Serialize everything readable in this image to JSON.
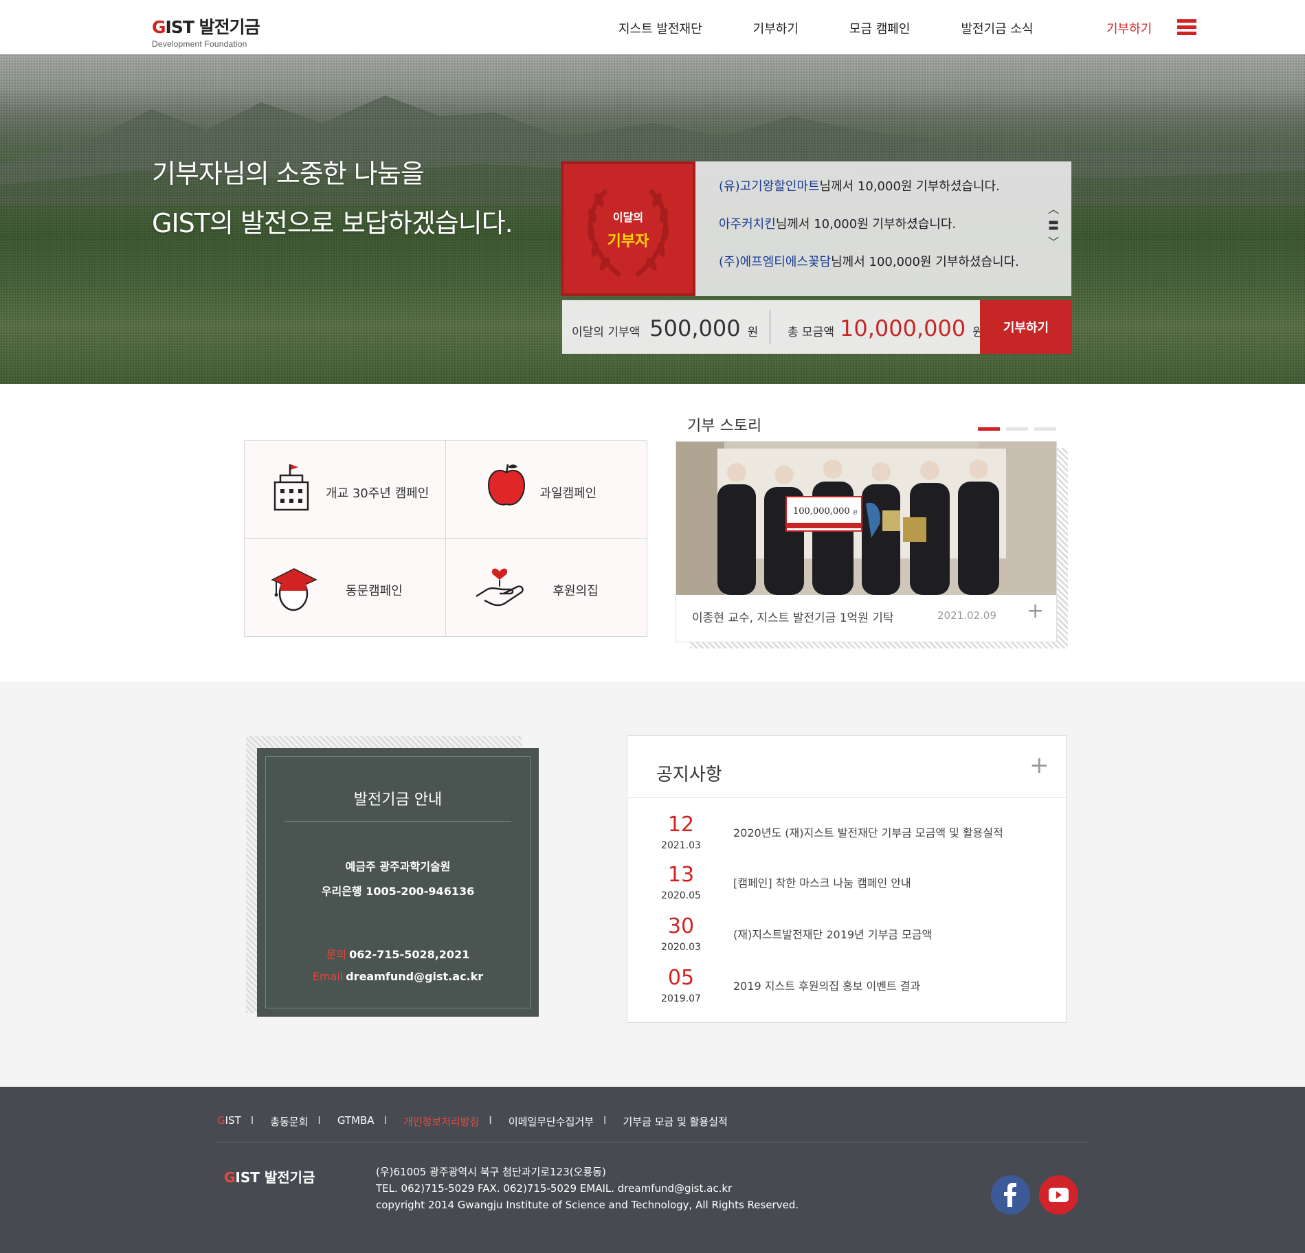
{
  "header": {
    "logo_gist": "GIST",
    "logo_name": "발전기금",
    "logo_sub": "Development Foundation",
    "nav": [
      "지스트 발전재단",
      "기부하기",
      "모금 캠페인",
      "발전기금 소식"
    ],
    "donate_label": "기부하기",
    "menu_icon": "hamburger-icon"
  },
  "hero": {
    "line1": "기부자님의 소중한 나눔을",
    "line2": "GIST의 발전으로 보답하겠습니다.",
    "badge_line1": "이달의",
    "badge_line2": "기부자",
    "donors": [
      {
        "name": "(유)고기왕할인마트",
        "text": "님께서 10,000원 기부하셨습니다."
      },
      {
        "name": "아주커치킨",
        "text": "님께서 10,000원 기부하셨습니다."
      },
      {
        "name": "(주)에프엠티에스꽃담",
        "text": "님께서 100,000원 기부하셨습니다."
      }
    ],
    "ctrl_up": "︿",
    "ctrl_mid": "〓",
    "ctrl_down": "﹀",
    "month_label": "이달의 기부액",
    "month_value": "500,000",
    "total_label": "총 모금액",
    "total_value": "10,000,000",
    "won": "원",
    "donate_button": "기부하기"
  },
  "campaigns": [
    {
      "label": "개교 30주년 캠페인",
      "icon": "building-icon"
    },
    {
      "label": "과일캠페인",
      "icon": "apple-icon"
    },
    {
      "label": "동문캠페인",
      "icon": "graduate-icon"
    },
    {
      "label": "후원의집",
      "icon": "hand-heart-icon"
    }
  ],
  "story": {
    "title": "기부 스토리",
    "caption": "이종현 교수, 지스트 발전기금 1억원 기탁",
    "date": "2021.02.09",
    "plus": "+",
    "image_label": "100,000,000",
    "image_label_unit": "원"
  },
  "fund": {
    "title": "발전기금 안내",
    "holder": "예금주 광주과학기술원",
    "account": "우리은행   1005-200-946136",
    "contact_label": "문의",
    "contact_value": "062-715-5028,2021",
    "email_label": "Email",
    "email_value": "dreamfund@gist.ac.kr"
  },
  "notice": {
    "title": "공지사항",
    "plus": "+",
    "items": [
      {
        "day": "12",
        "ym": "2021.03",
        "text": "2020년도 (재)지스트 발전재단  기부금 모금액 및 활용실적"
      },
      {
        "day": "13",
        "ym": "2020.05",
        "text": "[캠페인] 착한 마스크 나눔 캠페인 안내"
      },
      {
        "day": "30",
        "ym": "2020.03",
        "text": "(재)지스트발전재단 2019년 기부금 모금액"
      },
      {
        "day": "05",
        "ym": "2019.07",
        "text": "2019 지스트 후원의집 홍보 이벤트 결과"
      }
    ]
  },
  "footer": {
    "nav": [
      {
        "label": "GIST",
        "style": "gist"
      },
      {
        "label": "총동문회",
        "style": "normal"
      },
      {
        "label": "GTMBA",
        "style": "normal"
      },
      {
        "label": "개인정보처리방침",
        "style": "red"
      },
      {
        "label": "이메일무단수집거부",
        "style": "normal"
      },
      {
        "label": "기부금 모금 및 활용실적",
        "style": "normal"
      }
    ],
    "separator": "I",
    "logo_gist": "GIST",
    "logo_name": "발전기금",
    "address": "(우)61005 광주광역시 북구 첨단과기로123(오룡동)",
    "contact": "TEL. 062)715-5029    FAX. 062)715-5029   EMAIL. dreamfund@gist.ac.kr",
    "copyright": "copyright 2014 Gwangju Institute of Science and Technology, All Rights Reserved.",
    "facebook_icon": "facebook-icon",
    "youtube_icon": "youtube-icon"
  },
  "colors": {
    "accent_red": "#d32222",
    "fund_box": "#4a5450",
    "footer_bg": "#474b51",
    "donor_name_blue": "#1a3b91"
  }
}
